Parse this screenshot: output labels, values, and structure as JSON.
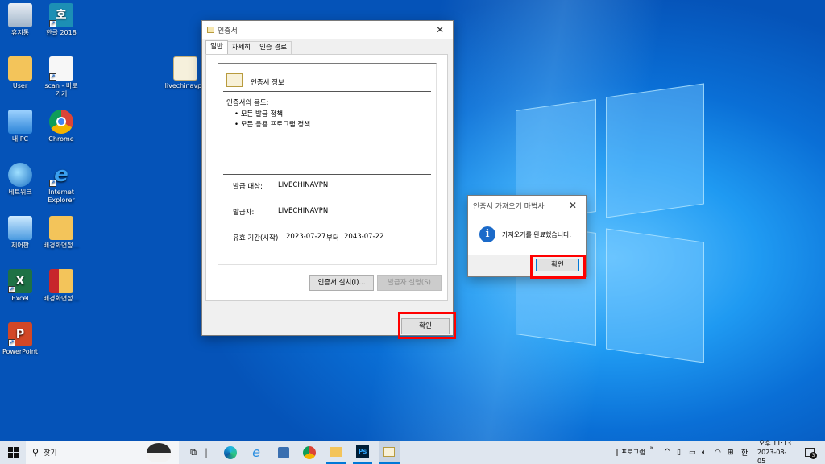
{
  "desktop": {
    "icons": [
      {
        "label": "휴지통",
        "icon": "recycle-bin-icon"
      },
      {
        "label": "한글 2018",
        "icon": "hangul-icon"
      },
      {
        "label": "User",
        "icon": "user-folder-icon"
      },
      {
        "label": "scan - 바로",
        "label2": "가기",
        "icon": "scan-shortcut-icon"
      },
      {
        "label": "livechinavpn",
        "icon": "certificate-file-icon"
      },
      {
        "label": "내 PC",
        "icon": "this-pc-icon"
      },
      {
        "label": "Chrome",
        "icon": "chrome-icon"
      },
      {
        "label": "네트워크",
        "icon": "network-icon"
      },
      {
        "label": "Internet",
        "label2": "Explorer",
        "icon": "internet-explorer-icon"
      },
      {
        "label": "제어판",
        "icon": "control-panel-icon"
      },
      {
        "label": "배경화면정...",
        "icon": "folder-icon"
      },
      {
        "label": "Excel",
        "icon": "excel-icon"
      },
      {
        "label": "배경화면정...",
        "icon": "archive-icon"
      },
      {
        "label": "PowerPoint",
        "icon": "powerpoint-icon"
      }
    ]
  },
  "cert_dialog": {
    "title": "인증서",
    "tabs": [
      "일반",
      "자세히",
      "인증 경로"
    ],
    "header": "인증서 정보",
    "purpose_label": "인증서의 용도:",
    "purposes": [
      "• 모든 발급 정책",
      "• 모든 응용 프로그램 정책"
    ],
    "issued_to_label": "발급 대상:",
    "issued_to": "LIVECHINAVPN",
    "issued_by_label": "발급자:",
    "issued_by": "LIVECHINAVPN",
    "validity_label": "유효 기간(시작)",
    "valid_from": "2023-07-27",
    "to_label": "부터",
    "valid_to": "2043-07-22",
    "install_button": "인증서 설치(I)...",
    "issuer_statement_button": "발급자 설명(S)",
    "ok_button": "확인"
  },
  "wizard_dialog": {
    "title": "인증서 가져오기 마법사",
    "message": "가져오기를 완료했습니다.",
    "ok_button": "확인"
  },
  "taskbar": {
    "search_placeholder": "찾기",
    "toolbar_label": "프로그램",
    "time": "오후 11:13",
    "date": "2023-08-05",
    "ime": "한",
    "notification_count": "3"
  },
  "colors": {
    "highlight": "#ff0000",
    "info_icon": "#1b6ac9",
    "taskbar": "#dfe6ef"
  }
}
